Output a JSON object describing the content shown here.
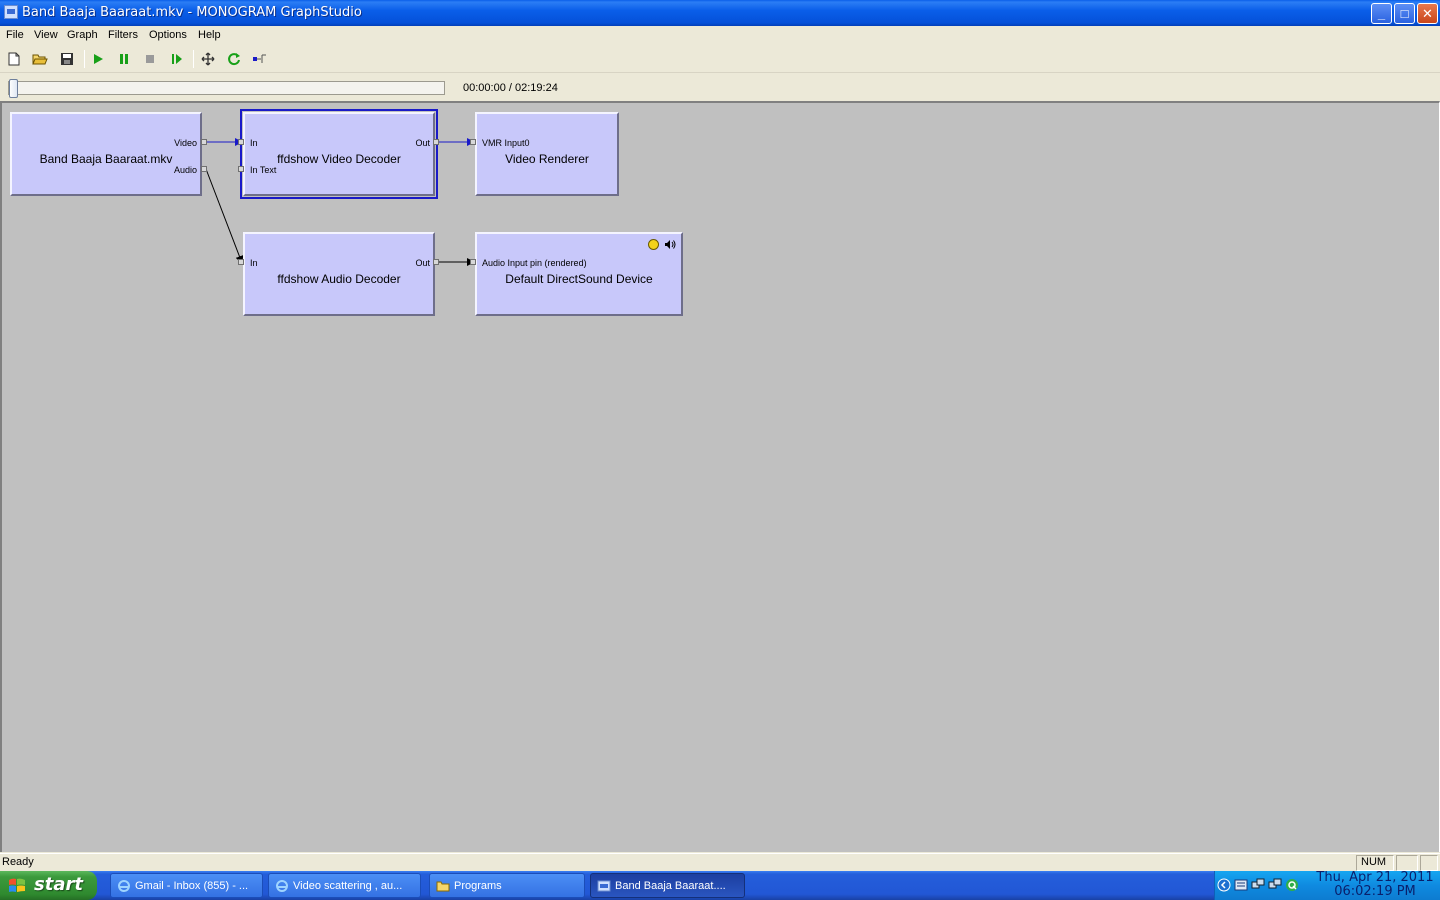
{
  "window": {
    "title": "Band Baaja Baaraat.mkv - MONOGRAM GraphStudio",
    "minimize_glyph": "_",
    "maximize_glyph": "□",
    "close_glyph": "✕"
  },
  "menu": [
    "File",
    "View",
    "Graph",
    "Filters",
    "Options",
    "Help"
  ],
  "toolbar": {
    "icons": [
      "new-file-icon",
      "open-folder-icon",
      "save-disk-icon",
      "play-icon",
      "pause-icon",
      "stop-icon",
      "step-frame-icon",
      "arrange-icon",
      "refresh-icon",
      "connect-icon"
    ]
  },
  "seek": {
    "time": "00:00:00 / 02:19:24",
    "position_fraction": 0.0
  },
  "graph": {
    "filters": {
      "source": {
        "name": "Band Baaja Baaraat.mkv",
        "out_pins": [
          "Video",
          "Audio"
        ]
      },
      "video_decoder": {
        "name": "ffdshow Video Decoder",
        "in_pins": [
          "In",
          "In Text"
        ],
        "out_pins": [
          "Out"
        ]
      },
      "video_renderer": {
        "name": "Video Renderer",
        "in_pins": [
          "VMR Input0"
        ]
      },
      "audio_decoder": {
        "name": "ffdshow Audio Decoder",
        "in_pins": [
          "In"
        ],
        "out_pins": [
          "Out"
        ]
      },
      "audio_renderer": {
        "name": "Default DirectSound Device",
        "in_pins": [
          "Audio Input pin (rendered)"
        ]
      }
    },
    "colors": {
      "filter_fill": "#c8c8fa",
      "video_wire": "#1a1ac8",
      "audio_wire": "#000000",
      "selection": "#1a1ac8"
    }
  },
  "status": {
    "text": "Ready",
    "num": "NUM"
  },
  "taskbar": {
    "start": "start",
    "tasks": [
      {
        "label": "Gmail - Inbox (855) - ...",
        "icon": "internet-explorer-icon"
      },
      {
        "label": "Video scattering , au...",
        "icon": "internet-explorer-icon"
      },
      {
        "label": "Programs",
        "icon": "folder-icon"
      },
      {
        "label": "Band Baaja Baaraat....",
        "icon": "graphstudio-icon"
      }
    ],
    "clock_line1": "Thu, Apr 21, 2011",
    "clock_line2": "06:02:19 PM"
  }
}
